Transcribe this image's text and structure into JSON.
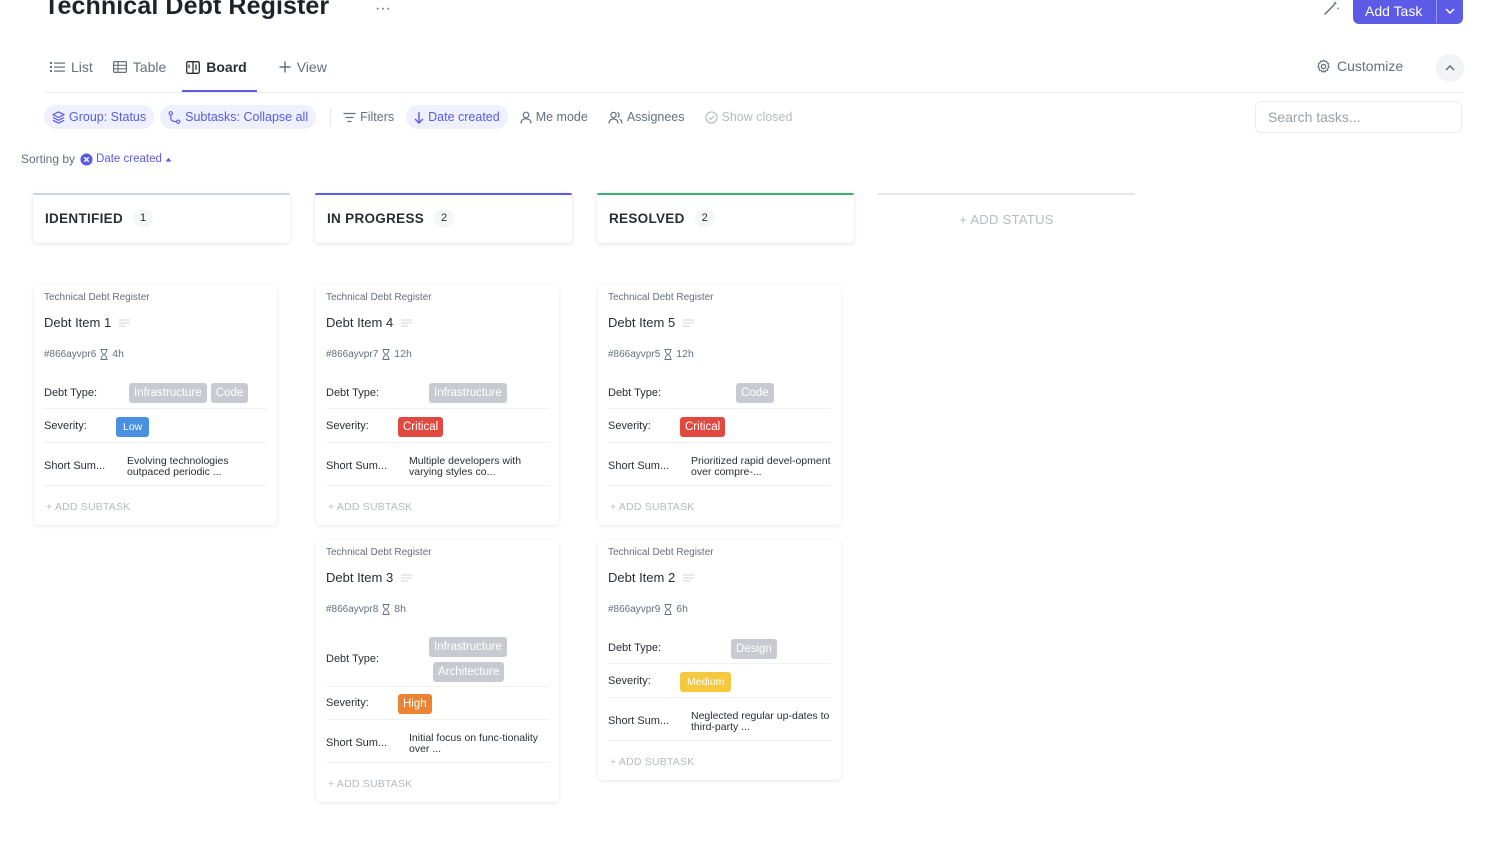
{
  "header": {
    "title": "Technical Debt Register",
    "more": "···",
    "add_task_label": "Add Task"
  },
  "tabs": [
    {
      "label": "List",
      "icon": "list-icon"
    },
    {
      "label": "Table",
      "icon": "table-icon"
    },
    {
      "label": "Board",
      "icon": "board-icon",
      "active": true
    },
    {
      "label": "View",
      "icon": "plus-icon"
    }
  ],
  "customize_label": "Customize",
  "filters": {
    "group": "Group: Status",
    "subtasks": "Subtasks: Collapse all",
    "filters": "Filters",
    "date_created": "Date created",
    "me_mode": "Me mode",
    "assignees": "Assignees",
    "show_closed": "Show closed"
  },
  "search": {
    "placeholder": "Search tasks..."
  },
  "sorting": {
    "label": "Sorting by",
    "field": "Date created"
  },
  "columns": [
    {
      "name": "IDENTIFIED",
      "count": "1",
      "color": "#d0d3d8"
    },
    {
      "name": "IN PROGRESS",
      "count": "2",
      "color": "#5b5be6"
    },
    {
      "name": "RESOLVED",
      "count": "2",
      "color": "#3cb371"
    }
  ],
  "add_status_label": "+ ADD STATUS",
  "labels": {
    "debt_type": "Debt Type:",
    "severity": "Severity:",
    "short_summary": "Short Sum...",
    "add_subtask": "+ ADD SUBTASK"
  },
  "cards": {
    "item1": {
      "list": "Technical Debt Register",
      "title": "Debt Item 1",
      "id": "#866ayvpr6",
      "estimate": "4h",
      "types": [
        "Infrastructure",
        "Code"
      ],
      "severity": "Low",
      "summary": "Evolving technologies outpaced periodic ..."
    },
    "item4": {
      "list": "Technical Debt Register",
      "title": "Debt Item 4",
      "id": "#866ayvpr7",
      "estimate": "12h",
      "types": [
        "Infrastructure"
      ],
      "severity": "Critical",
      "summary": "Multiple developers with varying styles co..."
    },
    "item3": {
      "list": "Technical Debt Register",
      "title": "Debt Item 3",
      "id": "#866ayvpr8",
      "estimate": "8h",
      "types": [
        "Infrastructure",
        "Architecture"
      ],
      "severity": "High",
      "summary": "Initial focus on func-tionality over ..."
    },
    "item5": {
      "list": "Technical Debt Register",
      "title": "Debt Item 5",
      "id": "#866ayvpr5",
      "estimate": "12h",
      "types": [
        "Code"
      ],
      "severity": "Critical",
      "summary": "Prioritized rapid devel-opment over compre-..."
    },
    "item2": {
      "list": "Technical Debt Register",
      "title": "Debt Item 2",
      "id": "#866ayvpr9",
      "estimate": "6h",
      "types": [
        "Design"
      ],
      "severity": "Medium",
      "summary": "Neglected regular up-dates to third-party ..."
    }
  }
}
